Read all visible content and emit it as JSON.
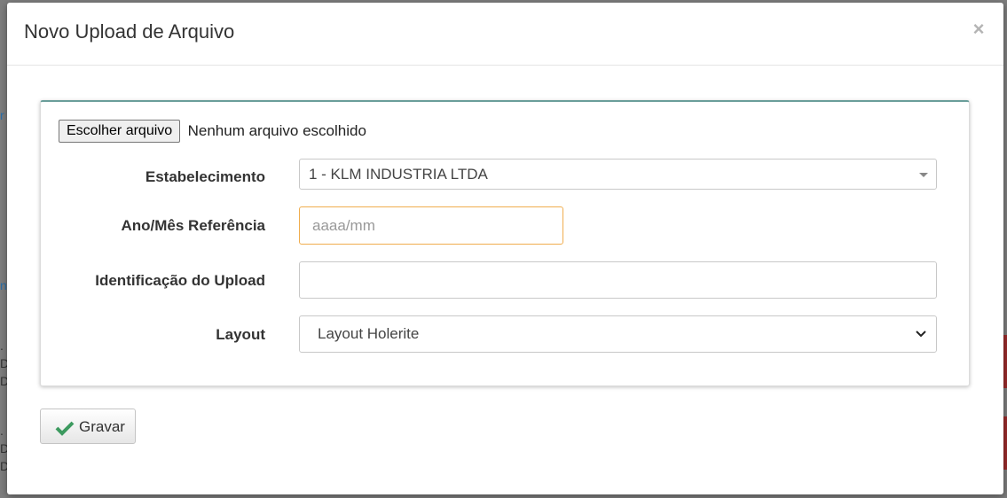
{
  "modal": {
    "title": "Novo Upload de Arquivo",
    "close_symbol": "×"
  },
  "file_input": {
    "button_label": "Escolher arquivo",
    "status": "Nenhum arquivo escolhido"
  },
  "form": {
    "estabelecimento": {
      "label": "Estabelecimento",
      "value": "1 - KLM INDUSTRIA LTDA"
    },
    "ano_mes": {
      "label": "Ano/Mês Referência",
      "placeholder": "aaaa/mm",
      "value": ""
    },
    "identificacao": {
      "label": "Identificação do Upload",
      "value": ""
    },
    "layout": {
      "label": "Layout",
      "value": "Layout Holerite"
    }
  },
  "actions": {
    "save_label": "Gravar"
  },
  "icons": {
    "close": "close-icon",
    "check": "check-icon",
    "dropdown": "chevron-down-icon"
  },
  "colors": {
    "accent_border": "#6a9e9a",
    "focus_border": "#f0ad4e",
    "check_green": "#3c9a5f"
  }
}
